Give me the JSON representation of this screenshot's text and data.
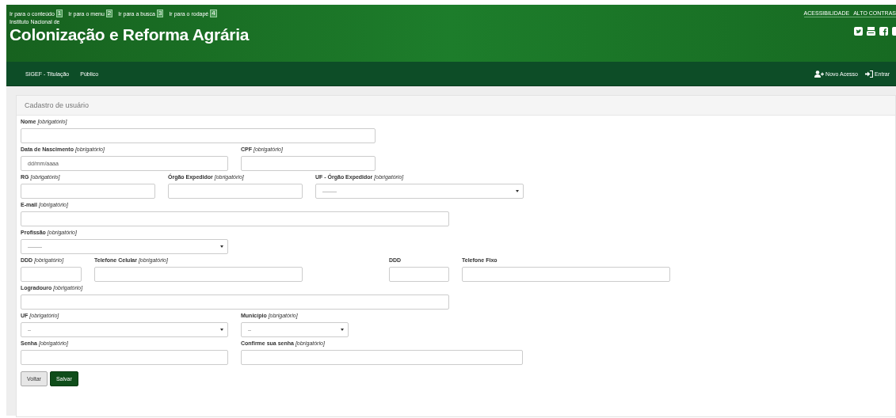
{
  "skip_links": [
    {
      "label": "Ir para o conteúdo",
      "key": "1"
    },
    {
      "label": "Ir para o menu",
      "key": "2"
    },
    {
      "label": "Ir para a busca",
      "key": "3"
    },
    {
      "label": "Ir para o rodapé",
      "key": "4"
    }
  ],
  "accessibility_links": [
    "ACESSIBILIDADE",
    "ALTO CONTRAS"
  ],
  "site": {
    "subtitle": "Instituto Nacional de",
    "title": "Colonização e Reforma Agrária"
  },
  "social_icons": [
    {
      "kind": "twitter"
    },
    {
      "kind": "youtube"
    },
    {
      "kind": "facebook"
    },
    {
      "kind": "partial"
    }
  ],
  "nav": {
    "items": [
      "SIGEF - Titulação",
      "Público"
    ],
    "actions": [
      {
        "kind": "user-plus",
        "label": "Novo Acesso"
      },
      {
        "kind": "sign-in",
        "label": "Entrar"
      }
    ]
  },
  "panel": {
    "title": "Cadastro de usuário"
  },
  "form_rows": [
    [
      {
        "label": "**Nome** *[obrigatório]*",
        "kind": "input"
      }
    ],
    [
      {
        "label": "**Data de Nascimento** *[obrigatório]*",
        "kind": "input",
        "placeholder": "dd/mm/aaaa"
      },
      {
        "label": "**CPF** *[obrigatório]*",
        "kind": "input"
      }
    ],
    [
      {
        "label": "**RG** *[obrigatório]*",
        "kind": "input"
      },
      {
        "label": "**Órgão Expedidor** *[obrigatório]*",
        "kind": "input"
      },
      {
        "label": "**UF - Órgão Expedidor** *[obrigatório]*",
        "kind": "select",
        "value": "---------"
      }
    ],
    [
      {
        "label": "**E-mail** *[obrigatório]*",
        "kind": "input"
      }
    ],
    [
      {
        "label": "**Profissão** *[obrigatório]*",
        "kind": "select",
        "value": "---------"
      }
    ],
    [
      {
        "label": "**DDD** *[obrigatório]*",
        "kind": "input"
      },
      {
        "label": "**Telefone Celular** *[obrigatório]*",
        "kind": "input"
      },
      {
        "label": "**DDD**",
        "kind": "input"
      },
      {
        "label": "**Telefone Fixo**",
        "kind": "input"
      }
    ],
    [
      {
        "label": "**Logradouro** *[obrigatório]*",
        "kind": "input"
      }
    ],
    [
      {
        "label": "**UF** *[obrigatório]*",
        "kind": "select",
        "value": "--"
      },
      {
        "label": "**Município** *[obrigatório]*",
        "kind": "select",
        "value": "--"
      }
    ],
    [
      {
        "label": "**Senha** *[obrigatório]*",
        "kind": "input"
      },
      {
        "label": "**Confirme sua senha** *[obrigatório]*",
        "kind": "input"
      }
    ]
  ],
  "buttons": [
    {
      "label": "Voltar",
      "kind": "secondary"
    },
    {
      "label": "Salvar",
      "kind": "primary"
    }
  ]
}
